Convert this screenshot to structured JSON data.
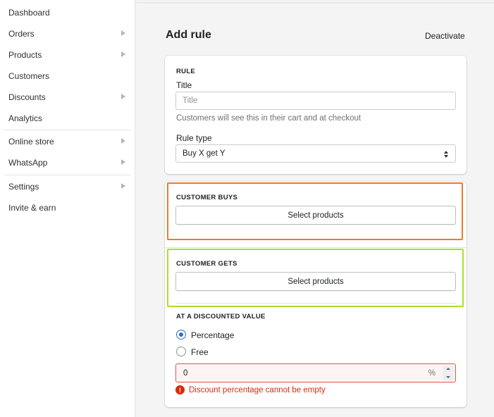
{
  "sidebar": {
    "items": [
      {
        "label": "Dashboard"
      },
      {
        "label": "Orders"
      },
      {
        "label": "Products"
      },
      {
        "label": "Customers"
      },
      {
        "label": "Discounts"
      },
      {
        "label": "Analytics"
      },
      {
        "label": "Online store"
      },
      {
        "label": "WhatsApp"
      },
      {
        "label": "Settings"
      },
      {
        "label": "Invite & earn"
      }
    ]
  },
  "header": {
    "title": "Add rule",
    "deactivate_label": "Deactivate"
  },
  "rule_card": {
    "heading": "RULE",
    "title_label": "Title",
    "title_placeholder": "Title",
    "title_value": "",
    "title_help": "Customers will see this in their cart and at checkout",
    "rule_type_label": "Rule type",
    "rule_type_value": "Buy X get Y"
  },
  "customer_buys": {
    "heading": "CUSTOMER BUYS",
    "button_label": "Select products"
  },
  "customer_gets": {
    "heading": "CUSTOMER GETS",
    "button_label": "Select products"
  },
  "discount": {
    "heading": "AT A DISCOUNTED VALUE",
    "options": [
      {
        "label": "Percentage",
        "checked": true
      },
      {
        "label": "Free",
        "checked": false
      }
    ],
    "value": "0",
    "suffix": "%",
    "error": "Discount percentage cannot be empty"
  },
  "colors": {
    "highlight_buys": "#f07a2a",
    "highlight_gets": "#a9e02a",
    "error": "#d82c0d",
    "radio_selected": "#2c6ecb"
  }
}
